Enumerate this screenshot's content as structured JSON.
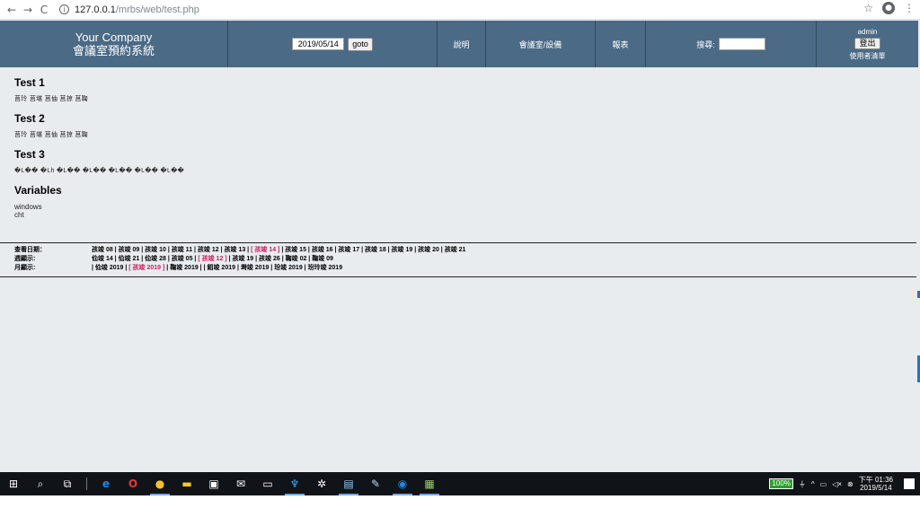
{
  "browser": {
    "url_host": "127.0.0.1",
    "url_path": "/mrbs/web/test.php"
  },
  "header": {
    "company_name": "Your Company",
    "system_name": "會議室預約系統",
    "date_value": "2019/05/14",
    "goto_label": "goto",
    "help_label": "說明",
    "rooms_label": "會議室/設備",
    "report_label": "報表",
    "search_label": "搜尋:",
    "user_name": "admin",
    "logout_label": "登出",
    "user_list_label": "使用者清單"
  },
  "sections": [
    {
      "title": "Test 1",
      "text": "莒玲 莒堪 莒伷 莒掠 莒鞠"
    },
    {
      "title": "Test 2",
      "text": "莒玲 莒堪 莒伷 莒掠 莒鞠"
    },
    {
      "title": "Test 3",
      "text": "�L�� �Lh �L�� �L�� �L�� �L�� �L��"
    }
  ],
  "variables": {
    "title": "Variables",
    "lines": [
      "windows",
      "cht"
    ]
  },
  "date_nav": {
    "day_label": "查看日期：",
    "week_label": "週顯示:",
    "month_label": "月顯示:",
    "day_links_before": "孩竣 08 | 孩竣 09 | 孩竣 10 | 孩竣 11 | 孩竣 12 | 孩竣 13 | ",
    "day_current": "[ 孩竣 14 ]",
    "day_links_after": " | 孩竣 15 | 孩竣 16 | 孩竣 17 | 孩竣 18 | 孩竣 19 | 孩竣 20 | 孩竣 21",
    "week_links_before": "佡竣 14 | 佡竣 21 | 佡竣 28 | 孩竣 05 | ",
    "week_current": "[ 孩竣 12 ]",
    "week_links_after": " | 孩竣 19 | 孩竣 26 | 鞠竣 02 | 鞠竣 09",
    "month_links_before": "| 佡竣 2019 | ",
    "month_current": "[ 孩竣 2019 ]",
    "month_links_after": " | 鞠竣 2019 | | 鉬竣 2019 | 塒竣 2019 | 玢竣 2019 | 玢玲竣 2019"
  },
  "taskbar": {
    "battery": "100%",
    "time": "下午 01:36",
    "date": "2019/5/14"
  },
  "icons": {
    "back": "←",
    "forward": "→",
    "reload": "C",
    "star": "☆",
    "menu": "⋮"
  }
}
